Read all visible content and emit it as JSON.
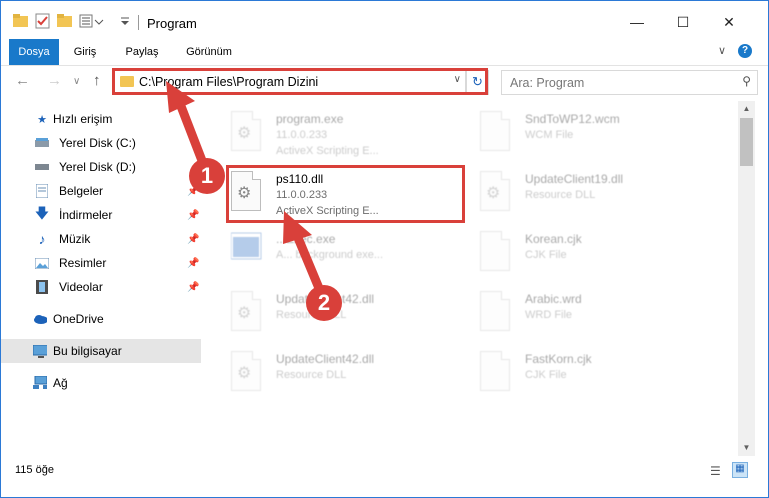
{
  "window": {
    "title": "Program",
    "minimize_icon": "minimize-icon",
    "maximize_icon": "maximize-icon",
    "close_icon": "close-icon"
  },
  "ribbon": {
    "tabs": [
      "Dosya",
      "Giriş",
      "Paylaş",
      "Görünüm"
    ],
    "accent": "#1979ca"
  },
  "nav": {
    "path": "C:\\Program Files\\Program Dizini",
    "search_placeholder": "Ara: Program"
  },
  "sidebar": {
    "items": [
      {
        "label": "Hızlı erişim",
        "icon": "star-icon"
      },
      {
        "label": "Yerel Disk (C:)",
        "icon": "drive-icon"
      },
      {
        "label": "Yerel Disk (D:)",
        "icon": "drive-icon"
      },
      {
        "label": "Belgeler",
        "icon": "documents-icon"
      },
      {
        "label": "İndirmeler",
        "icon": "download-icon"
      },
      {
        "label": "Müzik",
        "icon": "music-icon"
      },
      {
        "label": "Resimler",
        "icon": "pictures-icon"
      },
      {
        "label": "Videolar",
        "icon": "video-icon"
      },
      {
        "label": "OneDrive",
        "icon": "cloud-icon"
      },
      {
        "label": "Bu bilgisayar",
        "icon": "computer-icon"
      },
      {
        "label": "Ağ",
        "icon": "network-icon"
      }
    ]
  },
  "files": {
    "left": [
      {
        "name": "program.exe",
        "line2": "11.0.0.233",
        "line3": "ActiveX Scripting E..."
      },
      {
        "name": "ps110.dll",
        "line2": "11.0.0.233",
        "line3": "ActiveX Scripting E..."
      },
      {
        "name": "...Exec.exe",
        "line2": "",
        "line3": "A... background exe..."
      },
      {
        "name": "UpdateClient42.dll",
        "line2": "Resource DLL",
        "line3": ""
      },
      {
        "name": "UpdateClient42.dll",
        "line2": "Resource DLL",
        "line3": ""
      }
    ],
    "right": [
      {
        "name": "SndToWP12.wcm",
        "line2": "WCM File"
      },
      {
        "name": "UpdateClient19.dll",
        "line2": "Resource DLL"
      },
      {
        "name": "Korean.cjk",
        "line2": "CJK File"
      },
      {
        "name": "Arabic.wrd",
        "line2": "WRD File"
      },
      {
        "name": "FastKorn.cjk",
        "line2": "CJK File"
      }
    ]
  },
  "status": {
    "count": "115 öğe"
  },
  "callouts": [
    "1",
    "2"
  ],
  "highlight_color": "#d9403a"
}
